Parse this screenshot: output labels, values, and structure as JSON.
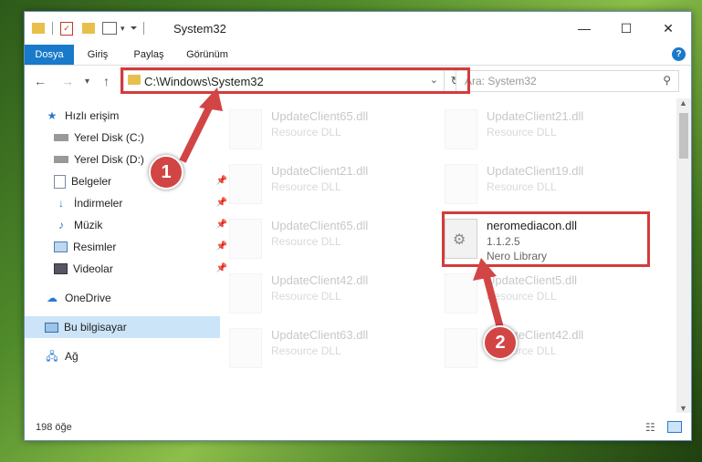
{
  "window": {
    "title": "System32",
    "minimize_glyph": "—",
    "maximize_glyph": "☐",
    "close_glyph": "✕"
  },
  "ribbon": {
    "tabs": [
      "Dosya",
      "Giriş",
      "Paylaş",
      "Görünüm"
    ],
    "help": "?"
  },
  "address": {
    "path": "C:\\Windows\\System32",
    "search_placeholder": "Ara: System32"
  },
  "sidebar": {
    "items": [
      {
        "label": "Hızlı erişim",
        "icon": "star-icon"
      },
      {
        "label": "Yerel Disk (C:)",
        "icon": "drive-icon"
      },
      {
        "label": "Yerel Disk (D:)",
        "icon": "drive-icon"
      },
      {
        "label": "Belgeler",
        "icon": "documents-icon"
      },
      {
        "label": "İndirmeler",
        "icon": "download-icon"
      },
      {
        "label": "Müzik",
        "icon": "music-icon"
      },
      {
        "label": "Resimler",
        "icon": "pictures-icon"
      },
      {
        "label": "Videolar",
        "icon": "videos-icon"
      },
      {
        "label": "OneDrive",
        "icon": "cloud-icon"
      },
      {
        "label": "Bu bilgisayar",
        "icon": "computer-icon"
      },
      {
        "label": "Ağ",
        "icon": "network-icon"
      }
    ]
  },
  "files": [
    {
      "name": "UpdateClient65.dll",
      "sub": "Resource DLL"
    },
    {
      "name": "UpdateClient21.dll",
      "sub": "Resource DLL"
    },
    {
      "name": "UpdateClient21.dll",
      "sub": "Resource DLL"
    },
    {
      "name": "UpdateClient19.dll",
      "sub": "Resource DLL"
    },
    {
      "name": "UpdateClient65.dll",
      "sub": "Resource DLL"
    },
    {
      "name": "UpdateClient42.dll",
      "sub": "Resource DLL"
    },
    {
      "name": "UpdateClient5.dll",
      "sub": "Resource DLL"
    },
    {
      "name": "UpdateClient63.dll",
      "sub": "Resource DLL"
    },
    {
      "name": "UpdateClient42.dll",
      "sub": "Resource DLL"
    }
  ],
  "highlight_file": {
    "name": "neromediacon.dll",
    "version": "1.1.2.5",
    "description": "Nero Library"
  },
  "status": {
    "count": "198 öğe"
  },
  "callouts": [
    "1",
    "2"
  ],
  "colors": {
    "accent": "#1979ca",
    "callout": "#d24545"
  }
}
